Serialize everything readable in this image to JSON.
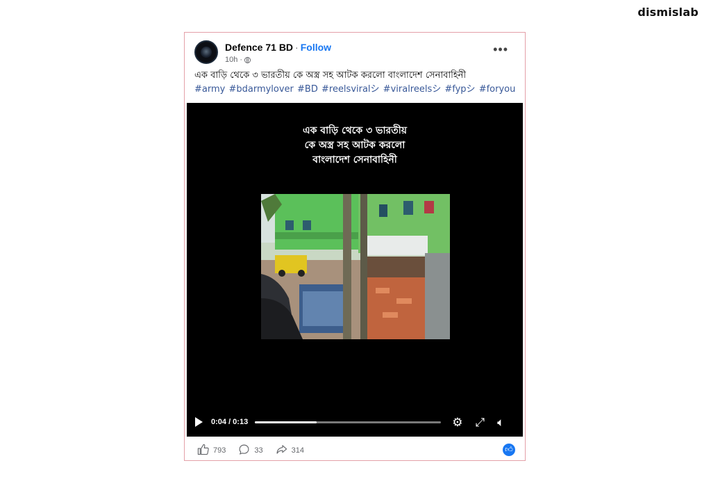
{
  "watermark": "dismislab",
  "post": {
    "author": "Defence 71 BD",
    "separator": "·",
    "follow_label": "Follow",
    "time": "10h",
    "more_label": "•••",
    "caption": "এক বাড়ি থেকে ৩ ভারতীয় কে অস্ত্র সহ আটক করলো বাংলাদেশ সেনাবাহিনী",
    "hashtags": "#army #bdarmylover #BD #reelsviralシ #viralreelsシ #fypシ #foryou"
  },
  "video": {
    "overlay_lines": [
      "এক বাড়ি থেকে ৩ ভারতীয়",
      "কে অস্ত্র সহ আটক করলো",
      "বাংলাদেশ সেনাবাহিনী"
    ],
    "time_display": "0:04 / 0:13",
    "progress": 0.33,
    "icons": [
      "play-icon",
      "settings-icon",
      "fullscreen-icon",
      "volume-icon"
    ]
  },
  "footer": {
    "likes": "793",
    "comments": "33",
    "shares": "314"
  },
  "colors": {
    "accent": "#1877f2",
    "border": "#e4a0a8"
  }
}
